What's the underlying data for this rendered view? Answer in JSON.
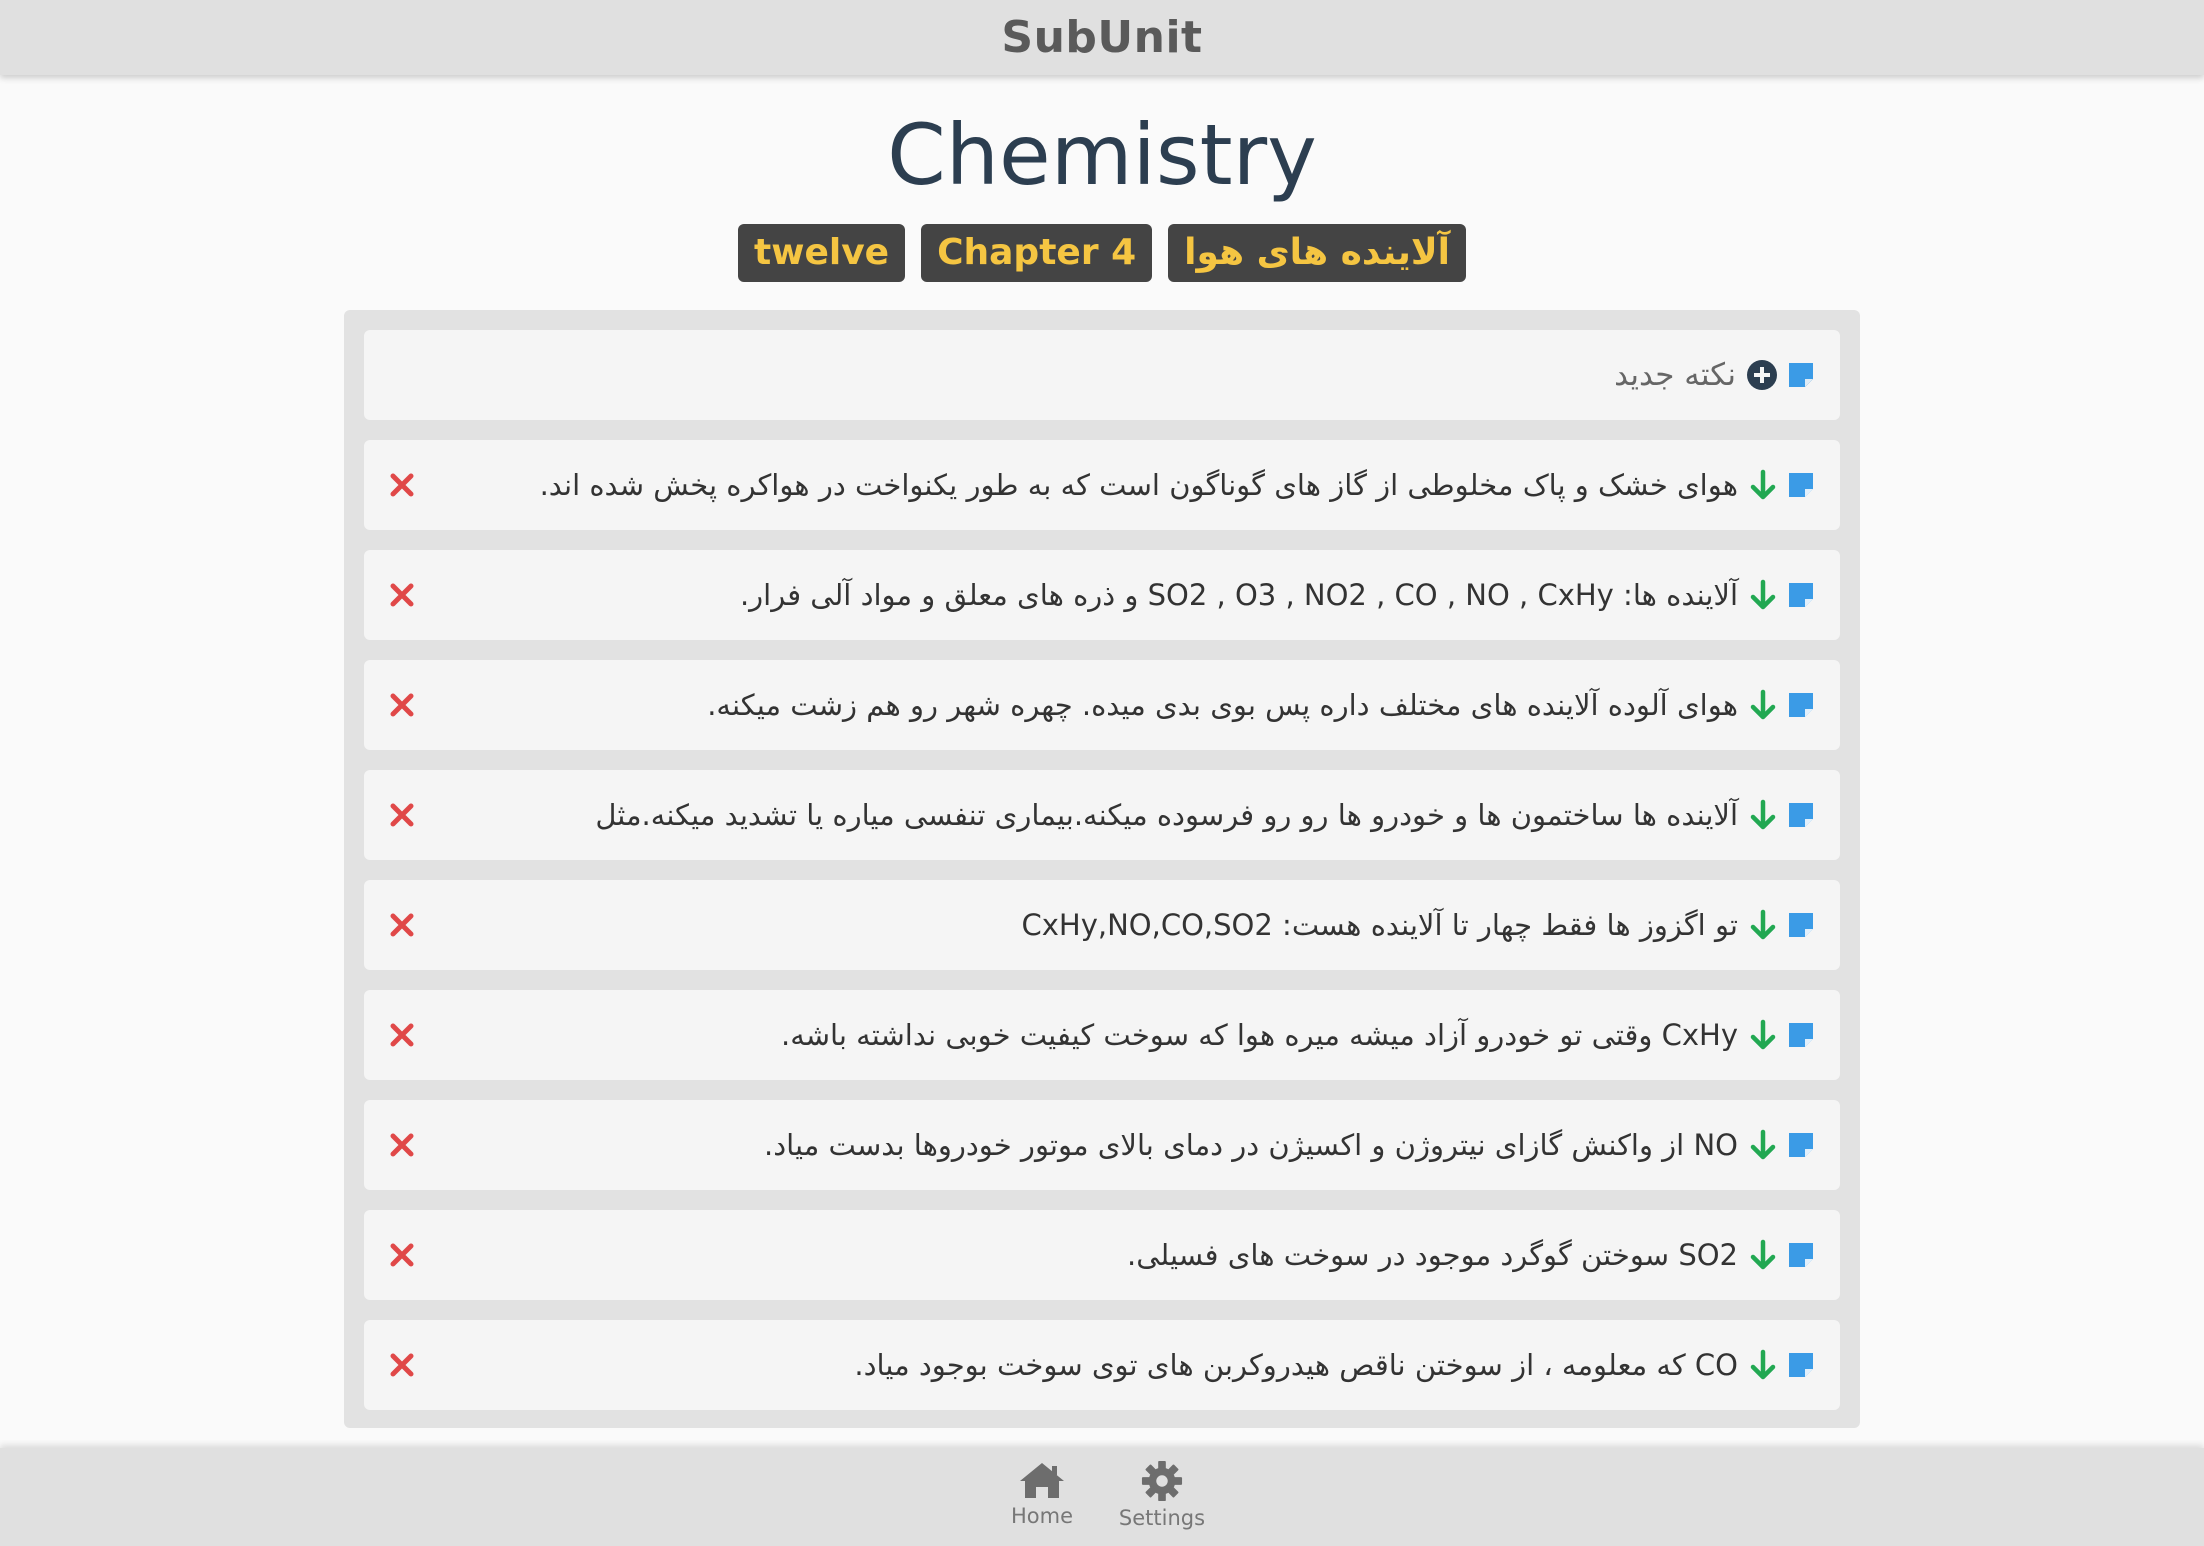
{
  "header": {
    "app_title": "SubUnit"
  },
  "page": {
    "title": "Chemistry",
    "tags": [
      "twelve",
      "Chapter 4",
      "آلاینده های هوا"
    ]
  },
  "new_note": {
    "label": "نکته جدید"
  },
  "notes": [
    {
      "text": "هوای خشک و پاک مخلوطی از گاز های گوناگون است که به طور یکنواخت در هواکره پخش شده اند."
    },
    {
      "text": "آلاینده ها: SO2 , O3 , NO2 , CO , NO , CxHy و ذره های معلق و مواد آلی فرار."
    },
    {
      "text": "هوای آلوده آلاینده های مختلف داره پس بوی بدی میده. چهره شهر رو هم زشت میکنه."
    },
    {
      "text": "آلاینده ها ساختمون ها و خودرو ها رو رو فرسوده میکنه.بیماری تنفسی میاره یا تشدید میکنه.مثل"
    },
    {
      "text": "تو اگزوز ها فقط چهار تا آلاینده هست: CxHy,NO,CO,SO2"
    },
    {
      "text": "CxHy وقتی تو خودرو آزاد میشه میره هوا که سوخت کیفیت خوبی نداشته باشه."
    },
    {
      "text": "NO از واکنش گازای نیتروژن و اکسیژن در دمای بالای موتور خودروها بدست میاد."
    },
    {
      "text": "SO2 سوختن گوگرد موجود در سوخت های فسیلی."
    },
    {
      "text": "CO که معلومه ، از سوختن ناقص هیدروکربن های توی سوخت بوجود میاد."
    }
  ],
  "bottom_nav": {
    "home": "Home",
    "settings": "Settings"
  },
  "colors": {
    "note_icon": "#3b9be6",
    "arrow": "#22a852",
    "delete": "#e04848",
    "tag_text": "#f5c542",
    "tag_bg": "#444444"
  },
  "icons": {
    "note": "sticky-note-icon",
    "arrow": "arrow-down-icon",
    "add": "plus-circle-icon",
    "delete": "close-icon",
    "home": "home-icon",
    "settings": "gear-icon"
  }
}
